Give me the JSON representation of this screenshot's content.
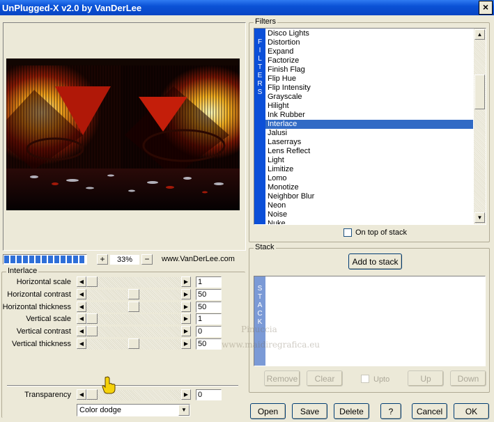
{
  "window": {
    "title": "UnPlugged-X v2.0 by VanDerLee",
    "close_glyph": "×"
  },
  "progress": {
    "fraction": 1.0
  },
  "zoom": {
    "plus": "+",
    "value": "33%",
    "minus": "−"
  },
  "website": "www.VanDerLee.com",
  "interlace": {
    "group_label": "Interlace",
    "params": [
      {
        "label": "Horizontal scale",
        "value": "1",
        "level": 0.0
      },
      {
        "label": "Horizontal contrast",
        "value": "50",
        "level": 0.5
      },
      {
        "label": "Horizontal thickness",
        "value": "50",
        "level": 0.5
      },
      {
        "label": "Vertical scale",
        "value": "1",
        "level": 0.0
      },
      {
        "label": "Vertical contrast",
        "value": "0",
        "level": 0.0
      },
      {
        "label": "Vertical thickness",
        "value": "50",
        "level": 0.5
      }
    ],
    "transparency": {
      "label": "Transparency",
      "value": "0",
      "level": 0.0
    },
    "blend_mode": "Color dodge"
  },
  "filters": {
    "group_label": "Filters",
    "tab_letters": [
      "F",
      "I",
      "L",
      "T",
      "E",
      "R",
      "S"
    ],
    "items": [
      "Disco Lights",
      "Distortion",
      "Expand",
      "Factorize",
      "Finish Flag",
      "Flip Hue",
      "Flip Intensity",
      "Grayscale",
      "Hilight",
      "Ink Rubber",
      "Interlace",
      "Jalusi",
      "Laserrays",
      "Lens Reflect",
      "Light",
      "Limitize",
      "Lomo",
      "Monotize",
      "Neighbor Blur",
      "Neon",
      "Noise",
      "Nuke"
    ],
    "selected": "Interlace",
    "on_top_label": "On top of stack"
  },
  "stack": {
    "group_label": "Stack",
    "add_label": "Add to stack",
    "tab_letters": [
      "S",
      "T",
      "A",
      "C",
      "K"
    ],
    "remove_label": "Remove",
    "clear_label": "Clear",
    "upto_label": "Upto",
    "up_label": "Up",
    "down_label": "Down"
  },
  "footer": {
    "open": "Open",
    "save": "Save",
    "delete": "Delete",
    "help": "?",
    "cancel": "Cancel",
    "ok": "OK"
  },
  "watermark": {
    "line1": "Pinuccia",
    "line2": "www.maidiregrafica.eu"
  },
  "colors": {
    "accent": "#0b4fd8",
    "selection": "#316ac5",
    "face": "#ece9d8"
  },
  "icons": {
    "cursor": "hand-pointer-icon"
  }
}
